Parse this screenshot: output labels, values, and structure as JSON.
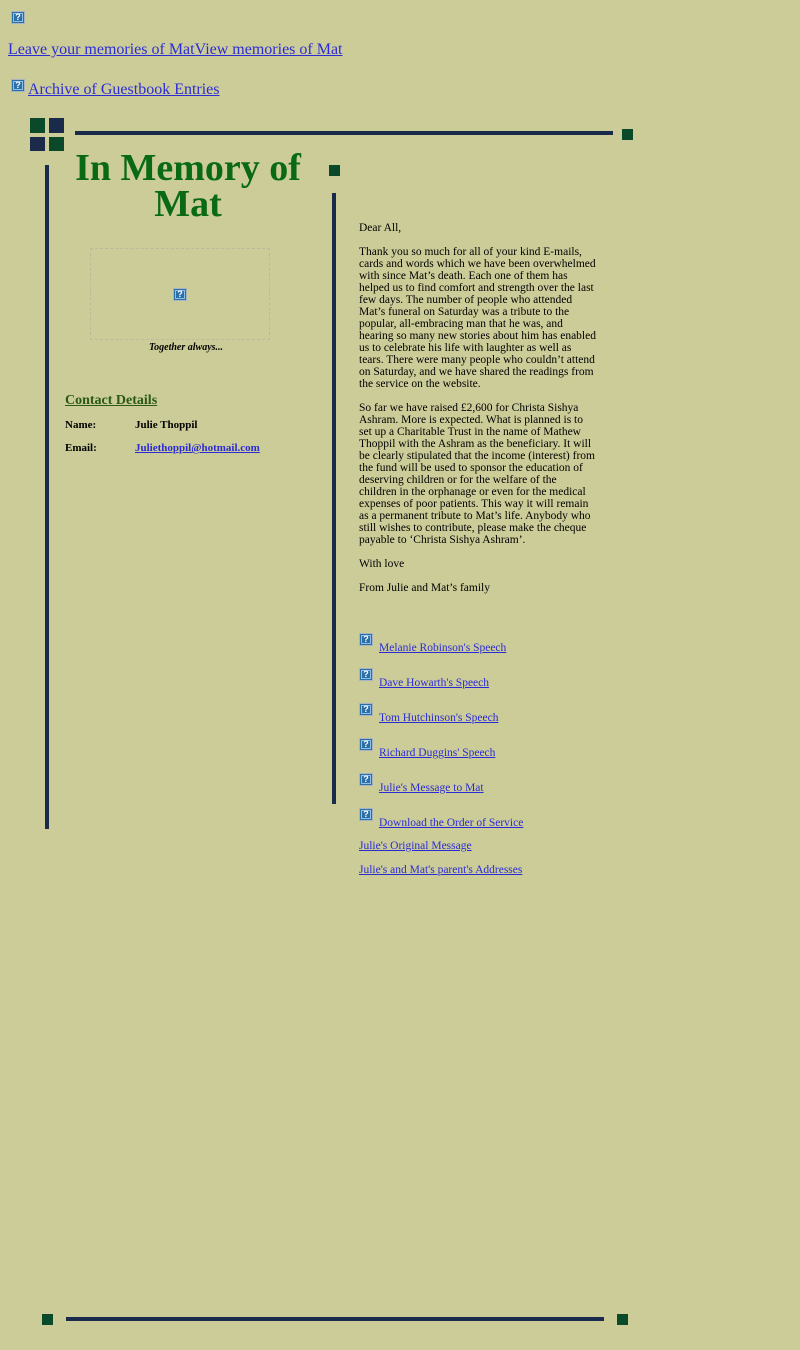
{
  "header": {
    "leave_link": "Leave your memories of MatView memories of Mat",
    "archive_link": "Archive of Guestbook Entries",
    "broken_image_glyph": "?"
  },
  "sidebar": {
    "title": "In Memory of Mat",
    "photo_caption": "Together always...",
    "contact": {
      "heading": "Contact Details",
      "name_label": "Name:",
      "name_value": "Julie Thoppil",
      "email_label": "Email:",
      "email_value": "Juliethoppil@hotmail.com"
    }
  },
  "letter": {
    "greeting": "Dear All,",
    "para1": "Thank you so much for all of your kind E-mails, cards and words which we have been overwhelmed with since Mat’s death. Each one of them has helped us to find comfort and strength over the last few days. The number of people who attended Mat’s funeral on Saturday was a tribute to the popular, all-embracing man that he was, and hearing so many new stories about him has enabled us to celebrate his life with laughter as well as tears. There were many people who couldn’t attend on Saturday, and we have shared the readings from the service on the website.",
    "para2": "So far we have raised £2,600 for Christa Sishya Ashram. More is expected. What is planned is to set up a Charitable Trust in the name of Mathew Thoppil with the Ashram as the beneficiary. It will be clearly stipulated that the income (interest) from the fund will be used to sponsor the education of deserving children or for the welfare of the children in the orphanage or even for the medical expenses of poor patients. This way it will remain as a permanent tribute to Mat’s life. Anybody who still wishes to contribute, please make the cheque payable to ‘Christa Sishya Ashram’.",
    "closing": "With love",
    "signature": "From Julie and Mat’s family"
  },
  "documents": [
    "Melanie Robinson's Speech",
    "Dave Howarth's Speech",
    "Tom Hutchinson's Speech",
    "Richard Duggins' Speech",
    "Julie's Message to Mat",
    "Download the Order of Service"
  ],
  "extra_links": [
    "Julie's Original Message",
    "Julie's and Mat's parent's Addresses"
  ],
  "colors": {
    "background": "#cccc99",
    "title_green": "#0a6a14",
    "square_green": "#0a4a2a",
    "line_navy": "#1a2a4a",
    "link_blue": "#2b2bd6"
  }
}
